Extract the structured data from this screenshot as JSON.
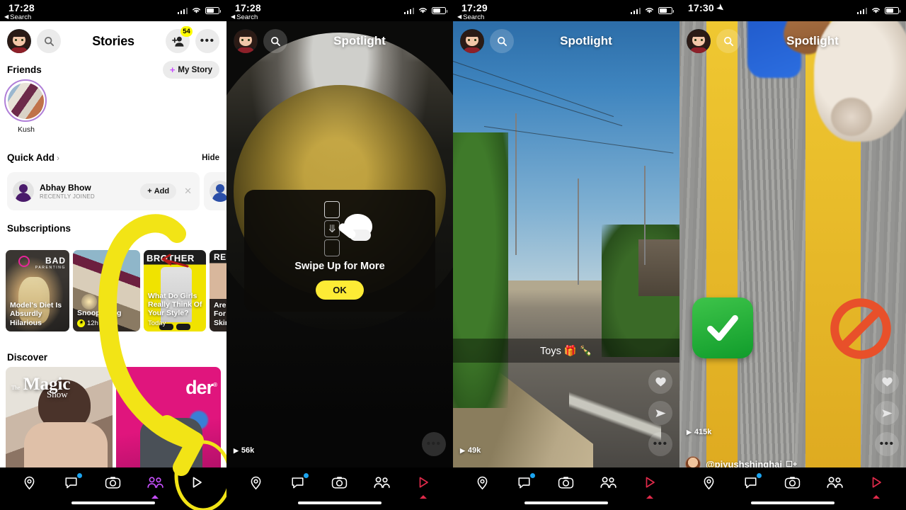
{
  "panels": [
    {
      "id": "stories",
      "status": {
        "time": "17:28",
        "back_label": "Search",
        "has_location_arrow": false
      },
      "header": {
        "title": "Stories",
        "add_friend_badge": "54",
        "more_icon": "more-dots-icon",
        "search_icon": "search-icon",
        "avatar": "profile-bitmoji-avatar"
      },
      "friends_section": {
        "label": "Friends",
        "my_story_button": "My Story",
        "friends": [
          {
            "name": "Kush"
          }
        ]
      },
      "quick_add": {
        "label": "Quick Add",
        "chevron": "›",
        "hide_label": "Hide",
        "entries": [
          {
            "name": "Abhay Bhow",
            "subtitle": "RECENTLY JOINED",
            "add_label": "Add",
            "dismiss_icon": "close-icon"
          }
        ]
      },
      "subscriptions": {
        "label": "Subscriptions",
        "tiles": [
          {
            "brand": "BAD",
            "brand_sub": "PARENTING",
            "caption": "Model's Diet Is Absurdly Hilarious",
            "meta": ""
          },
          {
            "brand": "",
            "brand_sub": "",
            "caption": "Snoop Dogg",
            "meta": "12h ago"
          },
          {
            "brand": "BROTHER",
            "brand_sub": "",
            "caption": "What Do Girls Really Think Of Your Style?",
            "meta": "Today"
          },
          {
            "brand": "REF",
            "brand_sub": "",
            "caption": "Are Y To Ris For \"R Skin?",
            "meta": ""
          }
        ]
      },
      "discover": {
        "label": "Discover",
        "tiles": [
          {
            "title_the": "The",
            "title_big": "Magic",
            "title_small": "Show"
          },
          {
            "title_big": "der",
            "registered": "®"
          }
        ]
      }
    },
    {
      "id": "spotlight-pot",
      "status": {
        "time": "17:28",
        "back_label": "Search",
        "has_location_arrow": false
      },
      "header": {
        "title": "Spotlight",
        "search_icon": "search-icon",
        "avatar": "profile-bitmoji-avatar"
      },
      "modal": {
        "text": "Swipe Up for More",
        "button": "OK",
        "graphic": "swipe-up-hand-icon"
      },
      "view_count": "56k",
      "rail": [
        "more-dots-icon"
      ]
    },
    {
      "id": "spotlight-road",
      "status": {
        "time": "17:29",
        "back_label": "Search",
        "has_location_arrow": false
      },
      "header": {
        "title": "Spotlight",
        "search_icon": "search-icon",
        "avatar": "profile-bitmoji-avatar"
      },
      "caption": "Toys 🎁 🍾",
      "view_count": "49k",
      "rail": [
        "heart-icon",
        "send-icon",
        "more-dots-icon"
      ]
    },
    {
      "id": "spotlight-crosswalk",
      "status": {
        "time": "17:30",
        "back_label": "",
        "has_location_arrow": true
      },
      "header": {
        "title": "Spotlight",
        "search_icon": "search-icon",
        "avatar": "profile-bitmoji-avatar"
      },
      "view_count": "415k",
      "handle": "@piyushshinghai",
      "subscribe_icon": "add-subscribe-icon",
      "rail": [
        "heart-icon",
        "send-icon",
        "more-dots-icon"
      ]
    }
  ],
  "nav": {
    "items": [
      {
        "name": "map",
        "icon": "location-pin-icon",
        "badge": false
      },
      {
        "name": "chat",
        "icon": "chat-bubble-icon",
        "badge": true
      },
      {
        "name": "camera",
        "icon": "camera-icon",
        "badge": false
      },
      {
        "name": "stories",
        "icon": "friends-icon",
        "badge": false
      },
      {
        "name": "spotlight",
        "icon": "play-triangle-icon",
        "badge": false
      }
    ],
    "active_panel1": "stories",
    "active_panels234": "spotlight"
  },
  "annotation": {
    "color": "#f2e416",
    "arrow": "curved-down-left-arrow",
    "circle": "spotlight-button-highlight-circle",
    "small_arrow_color": "#b21a1a"
  },
  "colors": {
    "snap_yellow": "#FFFC00",
    "accent_purple": "#c850ff",
    "accent_red": "#e02a4a",
    "badge_blue": "#1ba4f0",
    "annotation_yellow": "#f2e416"
  }
}
